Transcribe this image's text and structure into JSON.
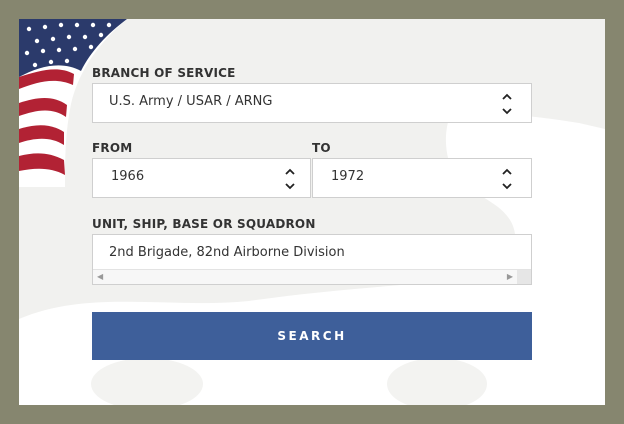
{
  "form": {
    "branch": {
      "label": "BRANCH OF SERVICE",
      "value": "U.S. Army / USAR / ARNG"
    },
    "from": {
      "label": "FROM",
      "value": "1966"
    },
    "to": {
      "label": "TO",
      "value": "1972"
    },
    "unit": {
      "label": "UNIT, SHIP, BASE OR SQUADRON",
      "value": "2nd Brigade, 82nd Airborne Division"
    },
    "search_label": "SEARCH"
  },
  "colors": {
    "frame": "#86866f",
    "panel": "#f1f1ef",
    "button": "#3e5f9a",
    "flag_red": "#b22234",
    "flag_blue": "#2b3a6b"
  },
  "icons": {
    "stepper": "up-down-chevron-icon",
    "flag": "american-flag-icon",
    "scroll_left": "scroll-left-arrow-icon",
    "scroll_right": "scroll-right-arrow-icon"
  }
}
